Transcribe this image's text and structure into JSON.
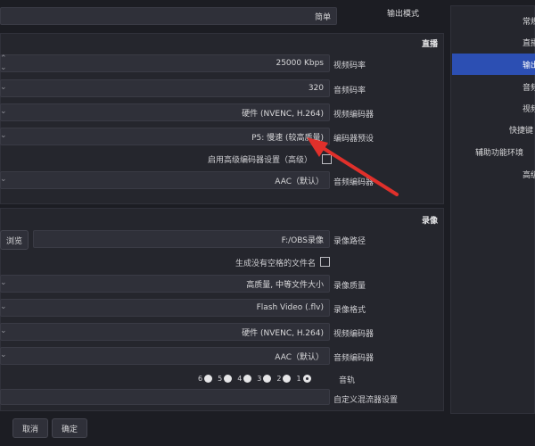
{
  "top": {
    "mode_value": "简单",
    "mode_label": "输出模式"
  },
  "stream": {
    "title": "直播",
    "rows": [
      {
        "label": "视频码率",
        "value": "25000 Kbps"
      },
      {
        "label": "音频码率",
        "value": "320"
      },
      {
        "label": "视频编码器",
        "value": "硬件 (NVENC, H.264)"
      },
      {
        "label": "编码器预设",
        "value": "P5: 慢速 (较高质量)"
      }
    ],
    "custom_encoder_checkbox": "启用高级编码器设置（高级）",
    "audio_encoder": {
      "label": "音频编码器",
      "value": "AAC（默认）"
    }
  },
  "record": {
    "title": "录像",
    "path": {
      "label": "录像路径",
      "value": "F:/OBS录像",
      "browse": "浏览"
    },
    "no_space_checkbox": "生成没有空格的文件名",
    "rows": [
      {
        "label": "录像质量",
        "value": "高质量, 中等文件大小"
      },
      {
        "label": "录像格式",
        "value": "Flash Video (.flv)"
      },
      {
        "label": "视频编码器",
        "value": "硬件 (NVENC, H.264)"
      },
      {
        "label": "音频编码器",
        "value": "AAC（默认）"
      }
    ],
    "tracks_label": "音轨",
    "tracks": [
      "1",
      "2",
      "3",
      "4",
      "5",
      "6"
    ],
    "custom_muxer_label": "自定义混流器设置"
  },
  "sidebar": {
    "items": [
      {
        "label": "常规"
      },
      {
        "label": "直播"
      },
      {
        "label": "输出"
      },
      {
        "label": "音频"
      },
      {
        "label": "视频"
      },
      {
        "label": "快捷键"
      },
      {
        "label": "辅助功能环境"
      },
      {
        "label": "高级"
      }
    ]
  },
  "footer": {
    "ok": "确定",
    "cancel": "取消"
  }
}
